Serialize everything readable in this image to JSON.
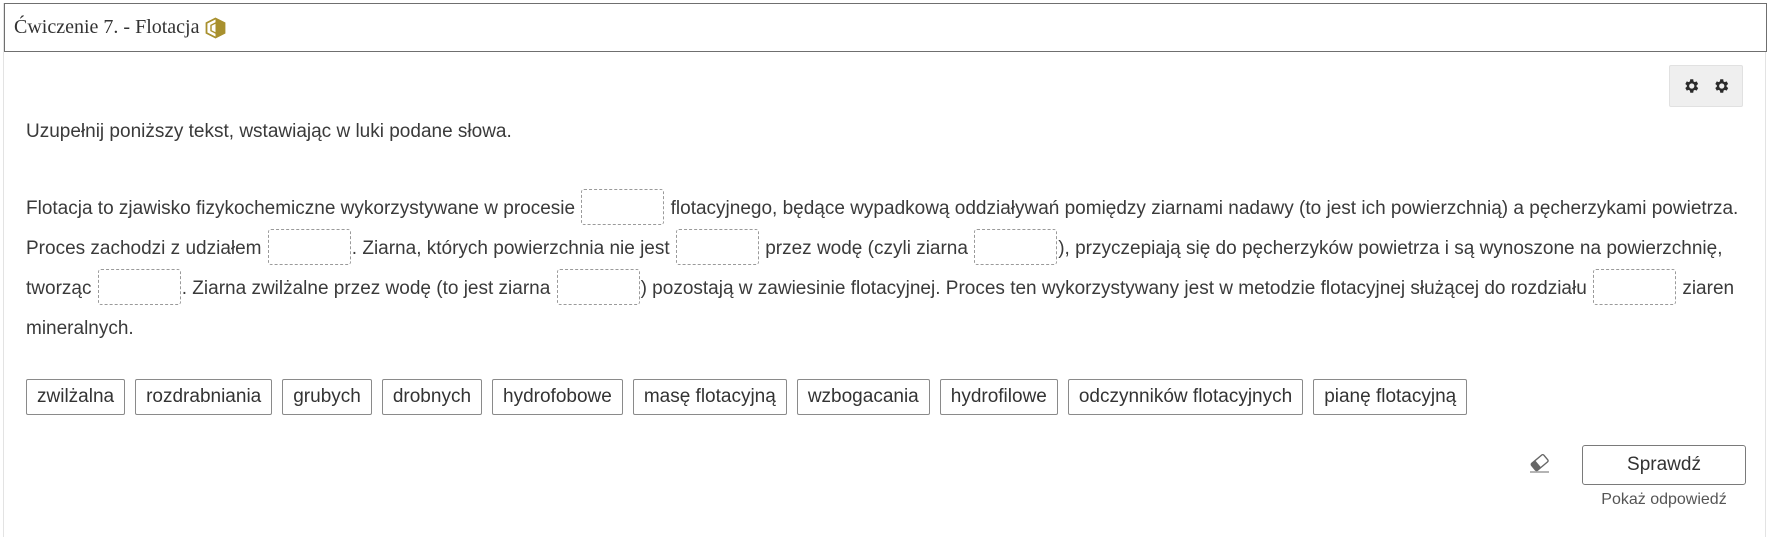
{
  "title": "Ćwiczenie 7. - Flotacja",
  "instruction": "Uzupełnij poniższy tekst, wstawiając w luki podane słowa.",
  "paragraph": {
    "t1": "Flotacja to zjawisko fizykochemiczne wykorzystywane w procesie ",
    "t2": " flotacyjnego, będące wypadkową oddziaływań pomiędzy ziarnami nadawy (to jest ich powierzchnią) a pęcherzykami powietrza. Proces zachodzi z udziałem ",
    "t3": ". Ziarna, których powierzchnia nie jest ",
    "t4": " przez wodę (czyli ziarna ",
    "t5": "), przyczepiają się do pęcherzyków powietrza i są wynoszone na powierzchnię, tworząc ",
    "t6": ". Ziarna zwilżalne przez wodę (to jest ziarna ",
    "t7": ") pozostają w zawiesinie flotacyjnej. Proces ten wykorzystywany jest w metodzie flotacyjnej służącej do rozdziału ",
    "t8": " ziaren mineralnych."
  },
  "words": [
    "zwilżalna",
    "rozdrabniania",
    "grubych",
    "drobnych",
    "hydrofobowe",
    "masę flotacyjną",
    "wzbogacania",
    "hydrofilowe",
    "odczynników flotacyjnych",
    "pianę flotacyjną"
  ],
  "buttons": {
    "check": "Sprawdź",
    "show_answer": "Pokaż odpowiedź"
  },
  "icons": {
    "title_badge": "interactive-badge-icon",
    "settings_1": "gear-icon",
    "settings_2": "gear-icon",
    "reset": "eraser-icon"
  },
  "colors": {
    "badge": "#a8902e",
    "gap_border": "#9a9a9a"
  }
}
